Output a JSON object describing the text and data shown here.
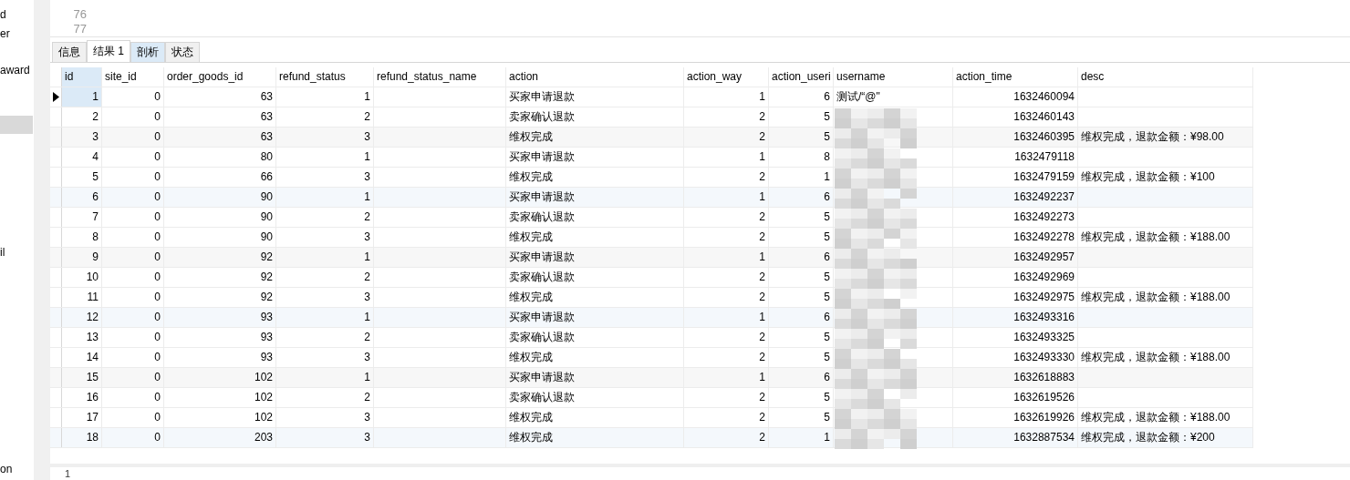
{
  "sidebar": {
    "items": [
      {
        "label": "d",
        "selected": false
      },
      {
        "label": "er",
        "selected": false
      },
      {
        "label": "award",
        "selected": false
      },
      {
        "selected": true
      },
      {
        "label": "il",
        "selected": false
      },
      {
        "label": "on",
        "selected": false
      }
    ]
  },
  "editor": {
    "line_numbers": [
      "76",
      "77"
    ]
  },
  "tabs": [
    {
      "label": "信息",
      "selected": false,
      "hover": false
    },
    {
      "label": "结果 1",
      "selected": true,
      "hover": false
    },
    {
      "label": "剖析",
      "selected": false,
      "hover": true
    },
    {
      "label": "状态",
      "selected": false,
      "hover": false
    }
  ],
  "table": {
    "columns": [
      {
        "label": "id",
        "selected": true
      },
      {
        "label": "site_id",
        "selected": false
      },
      {
        "label": "order_goods_id",
        "selected": false
      },
      {
        "label": "refund_status",
        "selected": false
      },
      {
        "label": "refund_status_name",
        "selected": false
      },
      {
        "label": "action",
        "selected": false
      },
      {
        "label": "action_way",
        "selected": false
      },
      {
        "label": "action_useri",
        "selected": false
      },
      {
        "label": "username",
        "selected": false
      },
      {
        "label": "action_time",
        "selected": false
      },
      {
        "label": "desc",
        "selected": false
      }
    ],
    "rows": [
      {
        "current": true,
        "cells": [
          "1",
          "0",
          "63",
          "1",
          null,
          "买家申请退款",
          "1",
          "6",
          "测试/“@\"",
          "1632460094",
          null
        ]
      },
      {
        "current": false,
        "cells": [
          "2",
          "0",
          "63",
          "2",
          null,
          "卖家确认退款",
          "2",
          "5",
          null,
          "1632460143",
          null
        ]
      },
      {
        "current": false,
        "cells": [
          "3",
          "0",
          "63",
          "3",
          null,
          "维权完成",
          "2",
          "5",
          null,
          "1632460395",
          "维权完成，退款金额：¥98.00"
        ]
      },
      {
        "current": false,
        "cells": [
          "4",
          "0",
          "80",
          "1",
          null,
          "买家申请退款",
          "1",
          "8",
          null,
          "1632479118",
          null
        ]
      },
      {
        "current": false,
        "cells": [
          "5",
          "0",
          "66",
          "3",
          null,
          "维权完成",
          "2",
          "1",
          null,
          "1632479159",
          "维权完成，退款金额：¥100"
        ]
      },
      {
        "current": false,
        "cells": [
          "6",
          "0",
          "90",
          "1",
          null,
          "买家申请退款",
          "1",
          "6",
          null,
          "1632492237",
          null
        ]
      },
      {
        "current": false,
        "cells": [
          "7",
          "0",
          "90",
          "2",
          null,
          "卖家确认退款",
          "2",
          "5",
          null,
          "1632492273",
          null
        ]
      },
      {
        "current": false,
        "cells": [
          "8",
          "0",
          "90",
          "3",
          null,
          "维权完成",
          "2",
          "5",
          null,
          "1632492278",
          "维权完成，退款金额：¥188.00"
        ]
      },
      {
        "current": false,
        "cells": [
          "9",
          "0",
          "92",
          "1",
          null,
          "买家申请退款",
          "1",
          "6",
          null,
          "1632492957",
          null
        ]
      },
      {
        "current": false,
        "cells": [
          "10",
          "0",
          "92",
          "2",
          null,
          "卖家确认退款",
          "2",
          "5",
          null,
          "1632492969",
          null
        ]
      },
      {
        "current": false,
        "cells": [
          "11",
          "0",
          "92",
          "3",
          null,
          "维权完成",
          "2",
          "5",
          null,
          "1632492975",
          "维权完成，退款金额：¥188.00"
        ]
      },
      {
        "current": false,
        "cells": [
          "12",
          "0",
          "93",
          "1",
          null,
          "买家申请退款",
          "1",
          "6",
          null,
          "1632493316",
          null
        ]
      },
      {
        "current": false,
        "cells": [
          "13",
          "0",
          "93",
          "2",
          null,
          "卖家确认退款",
          "2",
          "5",
          null,
          "1632493325",
          null
        ]
      },
      {
        "current": false,
        "cells": [
          "14",
          "0",
          "93",
          "3",
          null,
          "维权完成",
          "2",
          "5",
          null,
          "1632493330",
          "维权完成，退款金额：¥188.00"
        ]
      },
      {
        "current": false,
        "cells": [
          "15",
          "0",
          "102",
          "1",
          null,
          "买家申请退款",
          "1",
          "6",
          null,
          "1632618883",
          null
        ]
      },
      {
        "current": false,
        "cells": [
          "16",
          "0",
          "102",
          "2",
          null,
          "卖家确认退款",
          "2",
          "5",
          null,
          "1632619526",
          null
        ]
      },
      {
        "current": false,
        "cells": [
          "17",
          "0",
          "102",
          "3",
          null,
          "维权完成",
          "2",
          "5",
          null,
          "1632619926",
          "维权完成，退款金额：¥188.00"
        ]
      },
      {
        "current": false,
        "cells": [
          "18",
          "0",
          "203",
          "3",
          null,
          "维权完成",
          "2",
          "1",
          null,
          "1632887534",
          "维权完成，退款金额：¥200"
        ]
      }
    ]
  },
  "status_bar": {
    "line": "1"
  }
}
